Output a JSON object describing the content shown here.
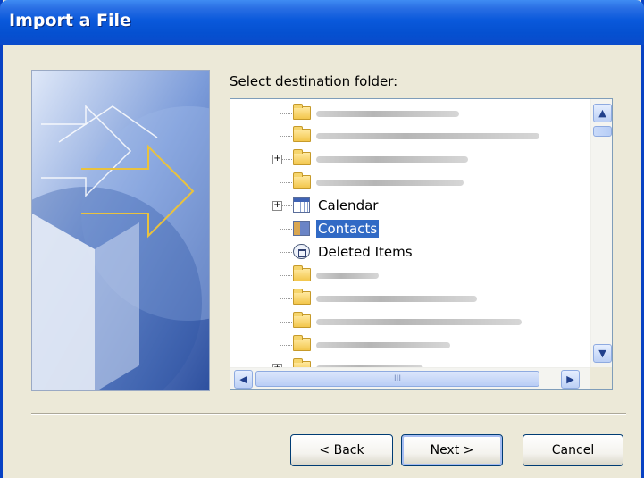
{
  "window": {
    "title": "Import a File"
  },
  "main": {
    "prompt": "Select destination folder:"
  },
  "tree": {
    "rows": [
      {
        "type": "folder",
        "expander": false,
        "blurred_width": 160
      },
      {
        "type": "folder",
        "expander": false,
        "blurred_width": 250
      },
      {
        "type": "folder",
        "expander": true,
        "blurred_width": 170
      },
      {
        "type": "folder",
        "expander": false,
        "blurred_width": 165
      },
      {
        "type": "calendar",
        "expander": true,
        "label": "Calendar",
        "icon": "calendar-icon"
      },
      {
        "type": "contacts",
        "expander": false,
        "label": "Contacts",
        "icon": "contacts-icon",
        "selected": true
      },
      {
        "type": "deleted",
        "expander": false,
        "label": "Deleted Items",
        "icon": "deleted-items-icon"
      },
      {
        "type": "folder",
        "expander": false,
        "blurred_width": 70
      },
      {
        "type": "folder",
        "expander": false,
        "blurred_width": 180
      },
      {
        "type": "folder",
        "expander": false,
        "blurred_width": 230
      },
      {
        "type": "folder",
        "expander": false,
        "blurred_width": 150
      },
      {
        "type": "folder",
        "expander": true,
        "blurred_width": 120
      }
    ],
    "hscroll_grip": "III"
  },
  "buttons": {
    "back": "< Back",
    "next": "Next >",
    "cancel": "Cancel"
  },
  "colors": {
    "titlebar": "#0a59db",
    "selection": "#316ac5",
    "dialog_bg": "#ece9d8"
  }
}
